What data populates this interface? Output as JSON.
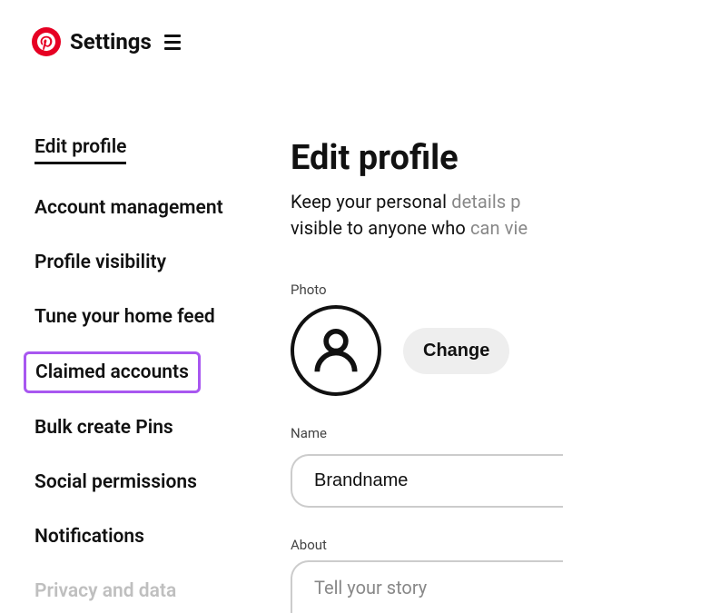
{
  "header": {
    "title": "Settings"
  },
  "sidebar": {
    "items": [
      {
        "label": "Edit profile"
      },
      {
        "label": "Account management"
      },
      {
        "label": "Profile visibility"
      },
      {
        "label": "Tune your home feed"
      },
      {
        "label": "Claimed accounts"
      },
      {
        "label": "Bulk create Pins"
      },
      {
        "label": "Social permissions"
      },
      {
        "label": "Notifications"
      },
      {
        "label": "Privacy and data"
      }
    ]
  },
  "main": {
    "title": "Edit profile",
    "subtitle_part1": "Keep your personal ",
    "subtitle_part2": "details p",
    "subtitle_part3": "visible to anyone who ",
    "subtitle_part4": "can vie",
    "photo_label": "Photo",
    "change_button": "Change",
    "name_label": "Name",
    "name_value": "Brandname",
    "about_label": "About",
    "about_placeholder": "Tell your story"
  }
}
